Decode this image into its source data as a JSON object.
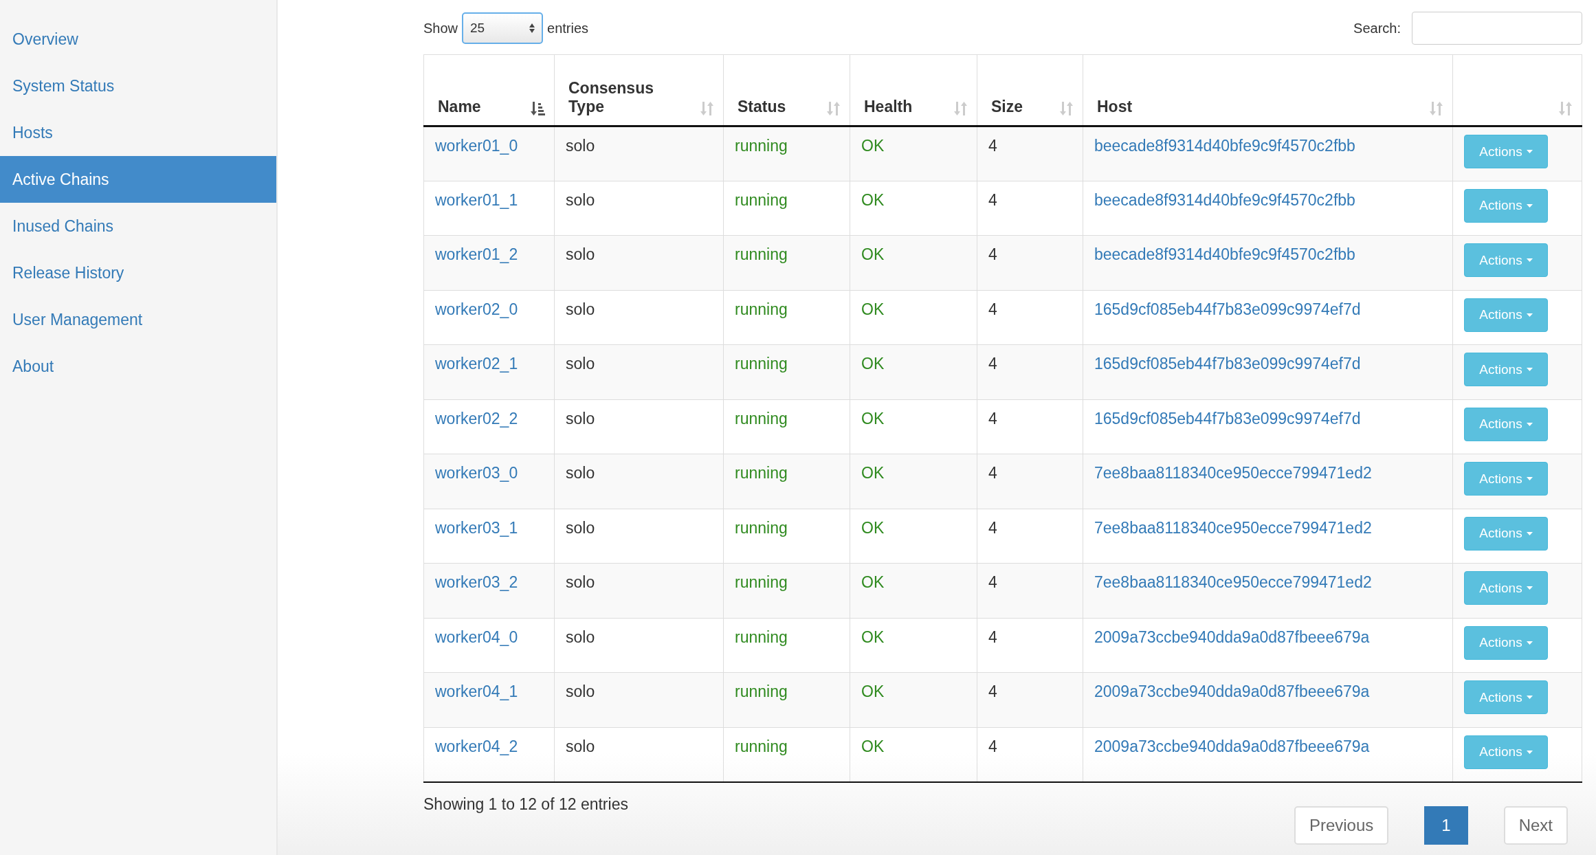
{
  "sidebar": {
    "items": [
      {
        "label": "Overview",
        "selected": false
      },
      {
        "label": "System Status",
        "selected": false
      },
      {
        "label": "Hosts",
        "selected": false
      },
      {
        "label": "Active Chains",
        "selected": true
      },
      {
        "label": "Inused Chains",
        "selected": false
      },
      {
        "label": "Release History",
        "selected": false
      },
      {
        "label": "User Management",
        "selected": false
      },
      {
        "label": "About",
        "selected": false
      }
    ]
  },
  "controls": {
    "show_label": "Show",
    "page_length": "25",
    "entries_label": "entries",
    "search_label": "Search:"
  },
  "table": {
    "columns": [
      {
        "label": "Name",
        "sorted": true
      },
      {
        "label": "Consensus Type",
        "sorted": false
      },
      {
        "label": "Status",
        "sorted": false
      },
      {
        "label": "Health",
        "sorted": false
      },
      {
        "label": "Size",
        "sorted": false
      },
      {
        "label": "Host",
        "sorted": false
      },
      {
        "sorted": false
      }
    ],
    "rows": [
      {
        "name": "worker01_0",
        "consensus_type": "solo",
        "status": "running",
        "health": "OK",
        "size": "4",
        "host": "beecade8f9314d40bfe9c9f4570c2fbb",
        "action": "Actions"
      },
      {
        "name": "worker01_1",
        "consensus_type": "solo",
        "status": "running",
        "health": "OK",
        "size": "4",
        "host": "beecade8f9314d40bfe9c9f4570c2fbb",
        "action": "Actions"
      },
      {
        "name": "worker01_2",
        "consensus_type": "solo",
        "status": "running",
        "health": "OK",
        "size": "4",
        "host": "beecade8f9314d40bfe9c9f4570c2fbb",
        "action": "Actions"
      },
      {
        "name": "worker02_0",
        "consensus_type": "solo",
        "status": "running",
        "health": "OK",
        "size": "4",
        "host": "165d9cf085eb44f7b83e099c9974ef7d",
        "action": "Actions"
      },
      {
        "name": "worker02_1",
        "consensus_type": "solo",
        "status": "running",
        "health": "OK",
        "size": "4",
        "host": "165d9cf085eb44f7b83e099c9974ef7d",
        "action": "Actions"
      },
      {
        "name": "worker02_2",
        "consensus_type": "solo",
        "status": "running",
        "health": "OK",
        "size": "4",
        "host": "165d9cf085eb44f7b83e099c9974ef7d",
        "action": "Actions"
      },
      {
        "name": "worker03_0",
        "consensus_type": "solo",
        "status": "running",
        "health": "OK",
        "size": "4",
        "host": "7ee8baa8118340ce950ecce799471ed2",
        "action": "Actions"
      },
      {
        "name": "worker03_1",
        "consensus_type": "solo",
        "status": "running",
        "health": "OK",
        "size": "4",
        "host": "7ee8baa8118340ce950ecce799471ed2",
        "action": "Actions"
      },
      {
        "name": "worker03_2",
        "consensus_type": "solo",
        "status": "running",
        "health": "OK",
        "size": "4",
        "host": "7ee8baa8118340ce950ecce799471ed2",
        "action": "Actions"
      },
      {
        "name": "worker04_0",
        "consensus_type": "solo",
        "status": "running",
        "health": "OK",
        "size": "4",
        "host": "2009a73ccbe940dda9a0d87fbeee679a",
        "action": "Actions"
      },
      {
        "name": "worker04_1",
        "consensus_type": "solo",
        "status": "running",
        "health": "OK",
        "size": "4",
        "host": "2009a73ccbe940dda9a0d87fbeee679a",
        "action": "Actions"
      },
      {
        "name": "worker04_2",
        "consensus_type": "solo",
        "status": "running",
        "health": "OK",
        "size": "4",
        "host": "2009a73ccbe940dda9a0d87fbeee679a",
        "action": "Actions"
      }
    ]
  },
  "footer": {
    "info": "Showing 1 to 12 of 12 entries",
    "pages": [
      {
        "label": "Previous",
        "selected": false
      },
      {
        "label": "1",
        "selected": true
      },
      {
        "label": "Next",
        "selected": false
      }
    ]
  }
}
